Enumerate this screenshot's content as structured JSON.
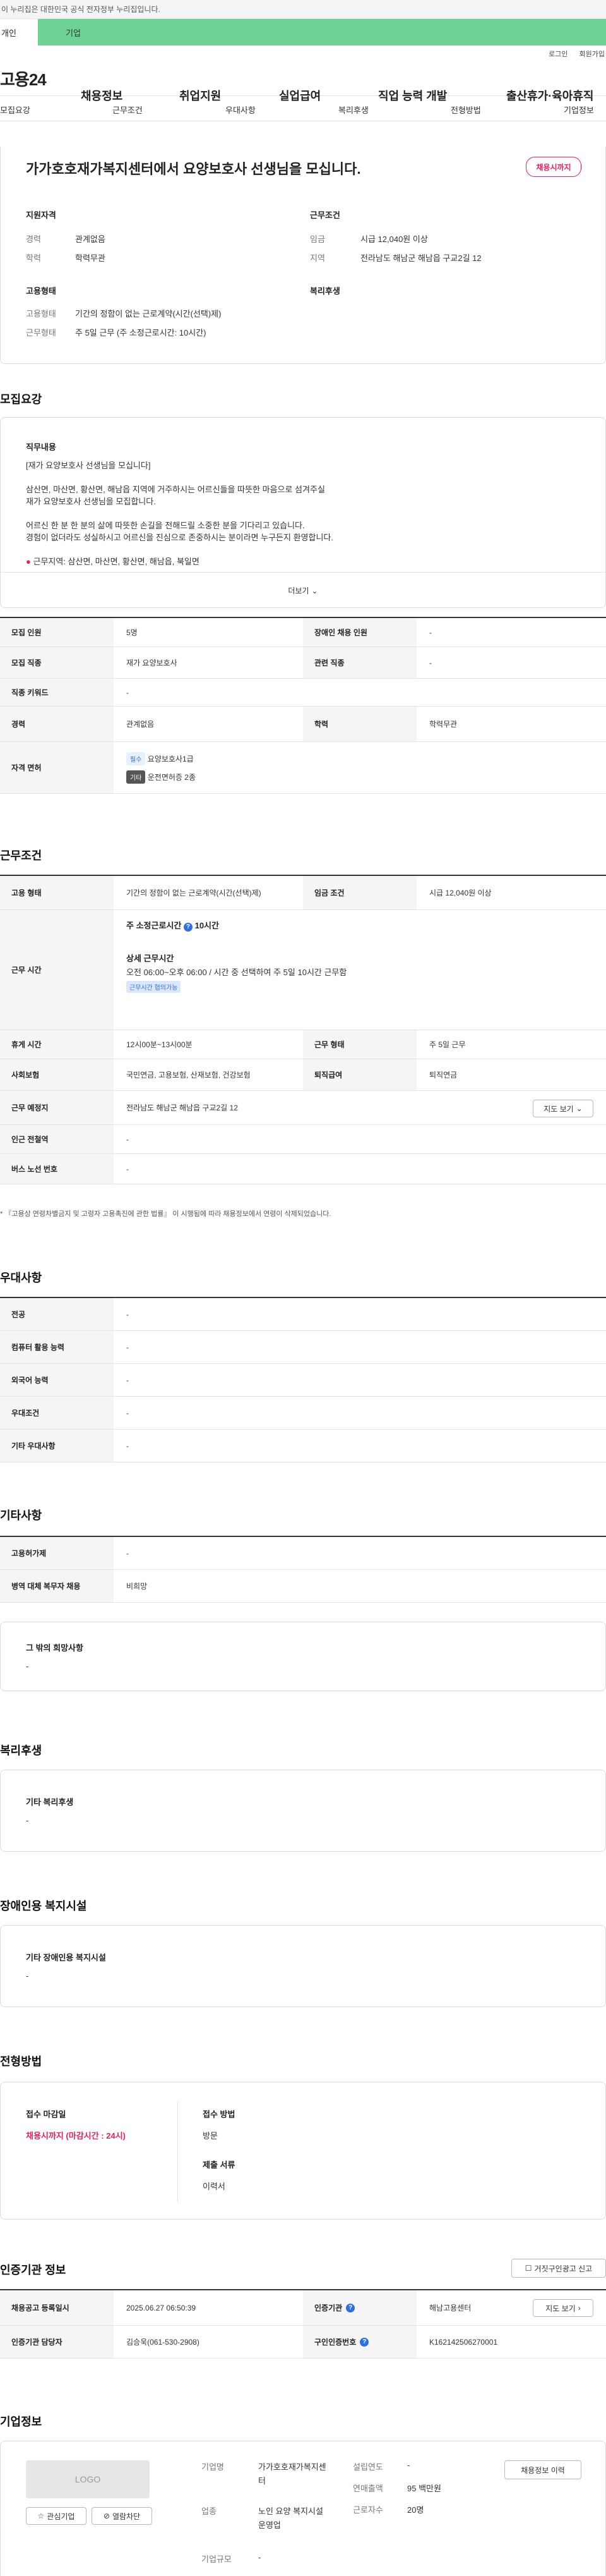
{
  "gov_bar": {
    "text": "이 누리집은 대한민국 공식 전자정부 누리집입니다."
  },
  "tabs": {
    "person": "개인",
    "business": "기업"
  },
  "util": {
    "login": "로그인",
    "signup": "회원가입"
  },
  "gnb": {
    "logo": "고용24",
    "items": [
      "채용정보",
      "취업지원",
      "실업급여",
      "직업 능력 개발",
      "출산휴가·육아휴직"
    ]
  },
  "subnav": [
    "모집요강",
    "근무조건",
    "우대사항",
    "복리후생",
    "전형방법",
    "기업정보"
  ],
  "summary": {
    "title": "가가호호재가복지센터에서 요양보호사 선생님을 모십니다.",
    "badge": "채용시까지",
    "qual_head": "지원자격",
    "career_lbl": "경력",
    "career_val": "관계없음",
    "edu_lbl": "학력",
    "edu_val": "학력무관",
    "cond_head": "근무조건",
    "wage_lbl": "임금",
    "wage_val": "시급 12,040원 이상",
    "region_lbl": "지역",
    "region_val": "전라남도 해남군 해남읍 구교2길 12",
    "emp_head": "고용형태",
    "emptype_lbl": "고용형태",
    "emptype_val": "기간의 정함이 없는 근로계약(시간(선택)제)",
    "worktype_lbl": "근무형태",
    "worktype_val": "주 5일 근무 (주 소정근로시간: 10시간)",
    "welfare_head": "복리후생"
  },
  "recruit": {
    "title": "모집요강",
    "duty_head": "직무내용",
    "duty_lines": [
      "[재가 요양보호사 선생님을 모십니다]",
      "",
      "삼산면, 마산면, 황산면, 해남읍 지역에 거주하시는 어르신들을 따뜻한 마음으로 섬겨주실",
      "재가 요양보호사 선생님을 모집합니다.",
      "",
      "어르신 한 분 한 분의 삶에 따뜻한 손길을 전해드릴 소중한 분을 기다리고 있습니다.",
      "경험이 없더라도 성실하시고 어르신을 진심으로 존중하시는 분이라면 누구든지 환영합니다."
    ],
    "area_line": "근무지역: 삼산면, 마산면, 황산면, 해남읍, 북일면",
    "more_label": "더보기",
    "rows": {
      "headcount_lbl": "모집 인원",
      "headcount_val": "5명",
      "disabled_lbl": "장애인 채용 인원",
      "disabled_val": "-",
      "job_lbl": "모집 직종",
      "job_val": "재가 요양보호사",
      "related_lbl": "관련 직종",
      "related_val": "-",
      "keyword_lbl": "직종 키워드",
      "keyword_val": "-",
      "career_lbl": "경력",
      "career_val": "관계없음",
      "edu_lbl": "학력",
      "edu_val": "학력무관",
      "license_lbl": "자격 면허",
      "license_chip1": "필수",
      "license_val1": "요양보호사1급",
      "license_chip2": "기타",
      "license_val2": "운전면허증 2종"
    }
  },
  "conditions": {
    "title": "근무조건",
    "emptype_lbl": "고용 형태",
    "emptype_val": "기간의 정함이 없는 근로계약(시간(선택)제)",
    "wage_lbl": "임금 조건",
    "wage_val": "시급 12,040원 이상",
    "hours_lbl": "근무 시간",
    "hours_weekly_lbl": "주 소정근로시간",
    "hours_weekly_val": "10시간",
    "hours_detail_head": "상세 근무시간",
    "hours_detail_val": "오전 06:00~오후 06:00 / 시간 중 선택하여 주 5일 10시간 근무함",
    "hours_chip": "근무시간 협의가능",
    "break_lbl": "휴게 시간",
    "break_val": "12시00분~13시00분",
    "worktype_lbl": "근무 형태",
    "worktype_val": "주 5일 근무",
    "insurance_lbl": "사회보험",
    "insurance_val": "국민연금, 고용보험, 산재보험, 건강보험",
    "severance_lbl": "퇴직급여",
    "severance_val": "퇴직연금",
    "place_lbl": "근무 예정지",
    "place_val": "전라남도 해남군 해남읍 구교2길 12",
    "map_btn": "지도 보기",
    "station_lbl": "인근 전철역",
    "station_val": "-",
    "bus_lbl": "버스 노선 번호",
    "bus_val": "-",
    "footnote": "* 『고용상 연령차별금지 및 고령자 고용촉진에 관한 법률』 이 시행됨에 따라 채용정보에서 연령이 삭제되었습니다."
  },
  "preferences": {
    "title": "우대사항",
    "rows": [
      {
        "label": "전공",
        "value": "-"
      },
      {
        "label": "컴퓨터 활용 능력",
        "value": "-"
      },
      {
        "label": "외국어 능력",
        "value": "-"
      },
      {
        "label": "우대조건",
        "value": "-"
      },
      {
        "label": "기타 우대사항",
        "value": "-"
      }
    ]
  },
  "other": {
    "title": "기타사항",
    "rows": [
      {
        "label": "고용허가제",
        "value": "-"
      },
      {
        "label": "병역 대체 복무자 채용",
        "value": "비희망"
      }
    ],
    "wish_head": "그 밖의 희망사항",
    "wish_val": "-"
  },
  "welfare": {
    "title": "복리후생",
    "head": "기타 복리후생",
    "val": "-"
  },
  "disabled_fac": {
    "title": "장애인용 복지시설",
    "head": "기타 장애인용 복지시설",
    "val": "-"
  },
  "selection": {
    "title": "전형방법",
    "deadline_head": "접수 마감일",
    "deadline_val": "채용시까지 (마감시간 : 24시)",
    "method_head": "접수 방법",
    "method_val": "방문",
    "docs_head": "제출 서류",
    "docs_val": "이력서"
  },
  "agency": {
    "title": "인증기관 정보",
    "report_btn": "거짓구인광고 신고",
    "reg_lbl": "채용공고 등록일시",
    "reg_val": "2025.06.27 06:50:39",
    "agency_lbl": "인증기관",
    "agency_val": "해남고용센터",
    "map_btn": "지도 보기",
    "manager_lbl": "인증기관 담당자",
    "manager_val": "김승욱(061-530-2908)",
    "reqno_lbl": "구인인증번호",
    "reqno_val": "K162142506270001"
  },
  "company": {
    "title": "기업정보",
    "logo_text": "LOGO",
    "fav_btn": "관심기업",
    "block_btn": "열람차단",
    "name_lbl": "기업명",
    "name_val": "가가호호재가복지센터",
    "industry_lbl": "업종",
    "industry_val": "노인 요양 복지시설 운영업",
    "size_lbl": "기업규모",
    "size_val": "-",
    "founded_lbl": "설립연도",
    "founded_val": "-",
    "sales_lbl": "연매출액",
    "sales_val": "95 백만원",
    "staff_lbl": "근로자수",
    "staff_val": "20명",
    "history_btn": "채용정보 이력"
  }
}
